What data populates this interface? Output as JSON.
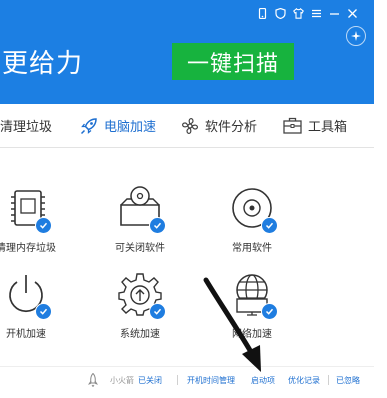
{
  "header": {
    "tagline": "更给力",
    "scan_button": "一键扫描",
    "window_icons": [
      "phone-icon",
      "shield-icon",
      "shirt-icon",
      "menu-icon",
      "minimize-icon",
      "close-icon"
    ]
  },
  "tabs": [
    {
      "label": "清理垃圾",
      "icon": "broom-icon",
      "active": false
    },
    {
      "label": "电脑加速",
      "icon": "rocket-icon",
      "active": true
    },
    {
      "label": "软件分析",
      "icon": "fan-icon",
      "active": false
    },
    {
      "label": "工具箱",
      "icon": "toolbox-icon",
      "active": false
    }
  ],
  "tiles": [
    {
      "label": "清理内存垃圾",
      "icon": "memory-chip-icon"
    },
    {
      "label": "可关闭软件",
      "icon": "disc-box-icon"
    },
    {
      "label": "常用软件",
      "icon": "disc-icon"
    },
    {
      "label": "开机加速",
      "icon": "power-icon"
    },
    {
      "label": "系统加速",
      "icon": "gear-icon"
    },
    {
      "label": "网络加速",
      "icon": "globe-monitor-icon"
    }
  ],
  "statusbar": {
    "xiaohuojian": "小火箭",
    "xiaohuojian_state": "已关闭",
    "boot_time": "开机时间管理",
    "startup_items": "启动项",
    "optimize_log": "优化记录",
    "ignored": "已忽略"
  },
  "colors": {
    "header_blue": "#1c7fe3",
    "scan_green": "#17b33e",
    "link_blue": "#1e6fd0"
  }
}
